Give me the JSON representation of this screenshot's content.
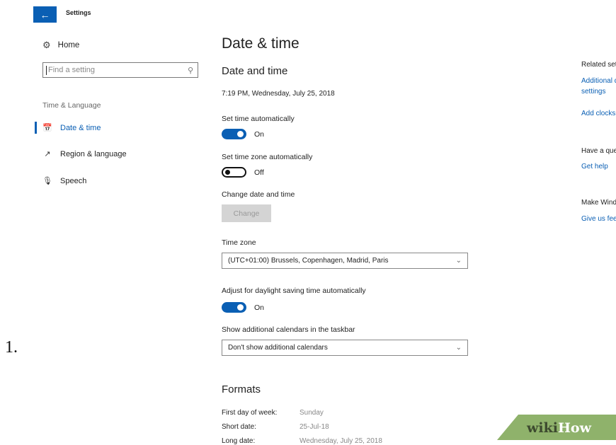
{
  "step_number": "1.",
  "window": {
    "title": "Settings",
    "back_icon": "arrow-left-icon"
  },
  "sidebar": {
    "home_label": "Home",
    "search_placeholder": "Find a setting",
    "section_label": "Time & Language",
    "items": [
      {
        "label": "Date & time",
        "icon": "calendar-clock-icon",
        "active": true
      },
      {
        "label": "Region & language",
        "icon": "region-language-icon",
        "active": false
      },
      {
        "label": "Speech",
        "icon": "microphone-icon",
        "active": false
      }
    ]
  },
  "main": {
    "page_title": "Date & time",
    "section_title": "Date and time",
    "current_datetime": "7:19 PM, Wednesday, July 25, 2018",
    "set_time_auto": {
      "label": "Set time automatically",
      "state": "On",
      "on": true
    },
    "set_timezone_auto": {
      "label": "Set time zone automatically",
      "state": "Off",
      "on": false
    },
    "change_datetime": {
      "label": "Change date and time",
      "button": "Change"
    },
    "time_zone": {
      "label": "Time zone",
      "value": "(UTC+01:00) Brussels, Copenhagen, Madrid, Paris"
    },
    "daylight_saving": {
      "label": "Adjust for daylight saving time automatically",
      "state": "On",
      "on": true
    },
    "calendars": {
      "label": "Show additional calendars in the taskbar",
      "value": "Don't show additional calendars"
    },
    "formats": {
      "title": "Formats",
      "rows": [
        {
          "key": "First day of week:",
          "value": "Sunday"
        },
        {
          "key": "Short date:",
          "value": "25-Jul-18"
        },
        {
          "key": "Long date:",
          "value": "Wednesday, July 25, 2018"
        }
      ]
    }
  },
  "right_panel": {
    "related_heading": "Related settings",
    "additional_settings_link_1": "Additional date, time & regional",
    "additional_settings_link_2": "settings",
    "add_clocks_link": "Add clocks for different time zones",
    "question_heading": "Have a question?",
    "get_help_link": "Get help",
    "make_windows_heading": "Make Windows better",
    "feedback_link": "Give us feedback"
  },
  "watermark": {
    "part1": "wiki",
    "part2": "How",
    "color": "#8fb26b"
  }
}
